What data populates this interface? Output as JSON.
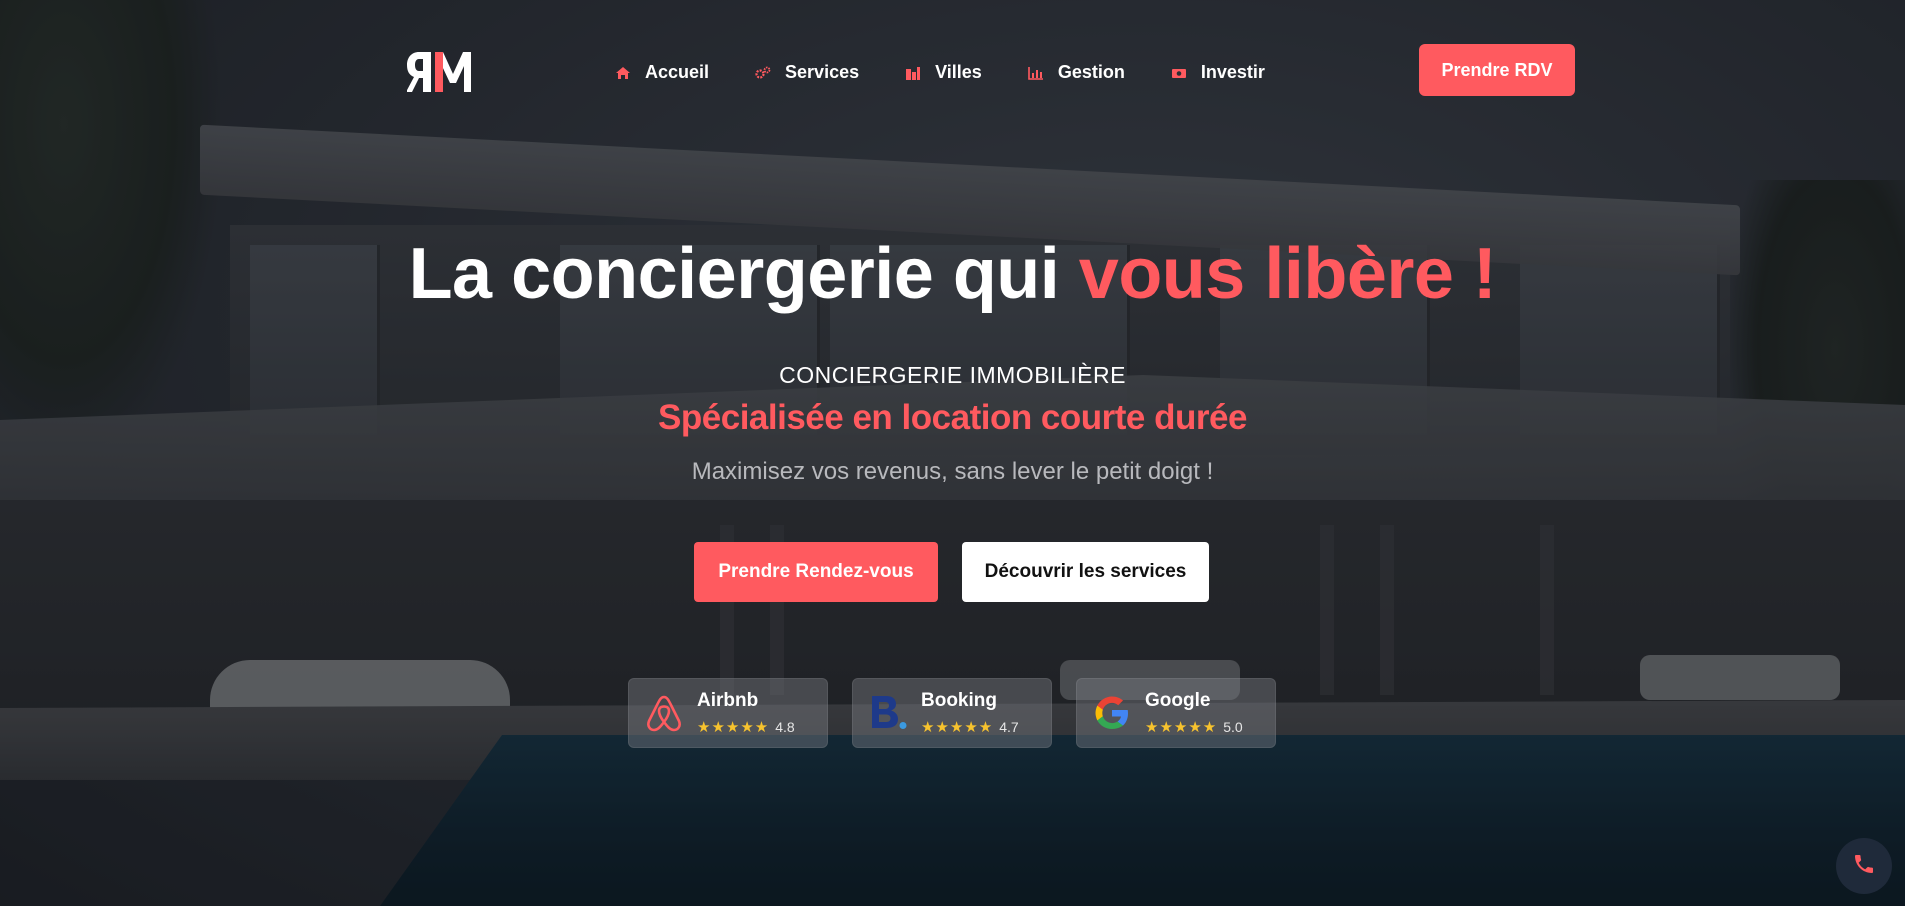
{
  "header": {
    "logo_text": "RM",
    "nav": [
      {
        "label": "Accueil",
        "icon": "home-icon"
      },
      {
        "label": "Services",
        "icon": "gears-icon"
      },
      {
        "label": "Villes",
        "icon": "city-icon"
      },
      {
        "label": "Gestion",
        "icon": "chart-icon"
      },
      {
        "label": "Investir",
        "icon": "money-icon"
      }
    ],
    "cta_label": "Prendre RDV"
  },
  "hero": {
    "title_white": "La conciergerie qui ",
    "title_accent": "vous libère !",
    "kicker": "CONCIERGERIE IMMOBILIÈRE",
    "subtitle": "Spécialisée en location courte durée",
    "tagline": "Maximisez vos revenus, sans lever le petit doigt !",
    "primary_cta": "Prendre Rendez-vous",
    "secondary_cta": "Découvrir les services"
  },
  "ratings": [
    {
      "name": "Airbnb",
      "stars": "★★★★★",
      "score": "4.8",
      "icon": "airbnb-logo-icon"
    },
    {
      "name": "Booking",
      "stars": "★★★★★",
      "score": "4.7",
      "icon": "booking-logo-icon"
    },
    {
      "name": "Google",
      "stars": "★★★★★",
      "score": "5.0",
      "icon": "google-logo-icon"
    }
  ],
  "colors": {
    "accent": "#ff5a5f",
    "star": "#f7c32e",
    "fab_bg": "#1f2a3a"
  },
  "floating": {
    "icon": "phone-icon"
  }
}
